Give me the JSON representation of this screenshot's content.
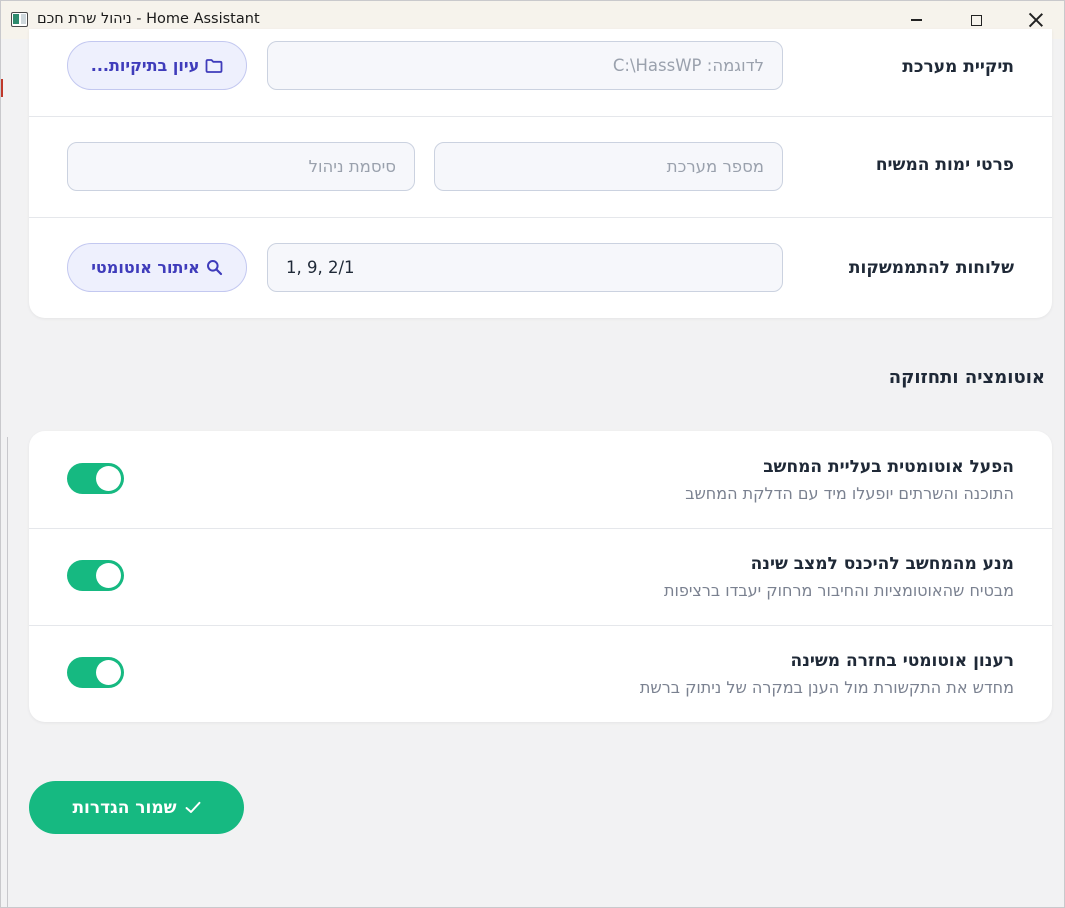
{
  "window": {
    "title": "ניהול שרת חכם - Home Assistant"
  },
  "system_card": {
    "folder": {
      "label": "תיקיית מערכת",
      "placeholder": "לדוגמה: C:\\HassWP",
      "browse_label": "עיון בתיקיות..."
    },
    "credentials": {
      "label": "פרטי ימות המשיח",
      "system_number_placeholder": "מספר מערכת",
      "admin_password_placeholder": "סיסמת ניהול"
    },
    "extensions": {
      "label": "שלוחות להתממשקות",
      "value": "1, 9, 2/1",
      "detect_label": "איתור אוטומטי"
    }
  },
  "automation": {
    "section_title": "אוטומציה ותחזוקה",
    "items": [
      {
        "title": "הפעל אוטומטית בעליית המחשב",
        "description": "התוכנה והשרתים יופעלו מיד עם הדלקת המחשב",
        "enabled": true
      },
      {
        "title": "מנע מהמחשב להיכנס למצב שינה",
        "description": "מבטיח שהאוטומציות והחיבור מרחוק יעבדו ברציפות",
        "enabled": true
      },
      {
        "title": "רענון אוטומטי בחזרה משינה",
        "description": "מחדש את התקשורת מול הענן במקרה של ניתוק ברשת",
        "enabled": true
      }
    ]
  },
  "actions": {
    "save_label": "שמור הגדרות"
  },
  "colors": {
    "accent_green": "#16b981",
    "accent_indigo": "#3f3cbb"
  }
}
